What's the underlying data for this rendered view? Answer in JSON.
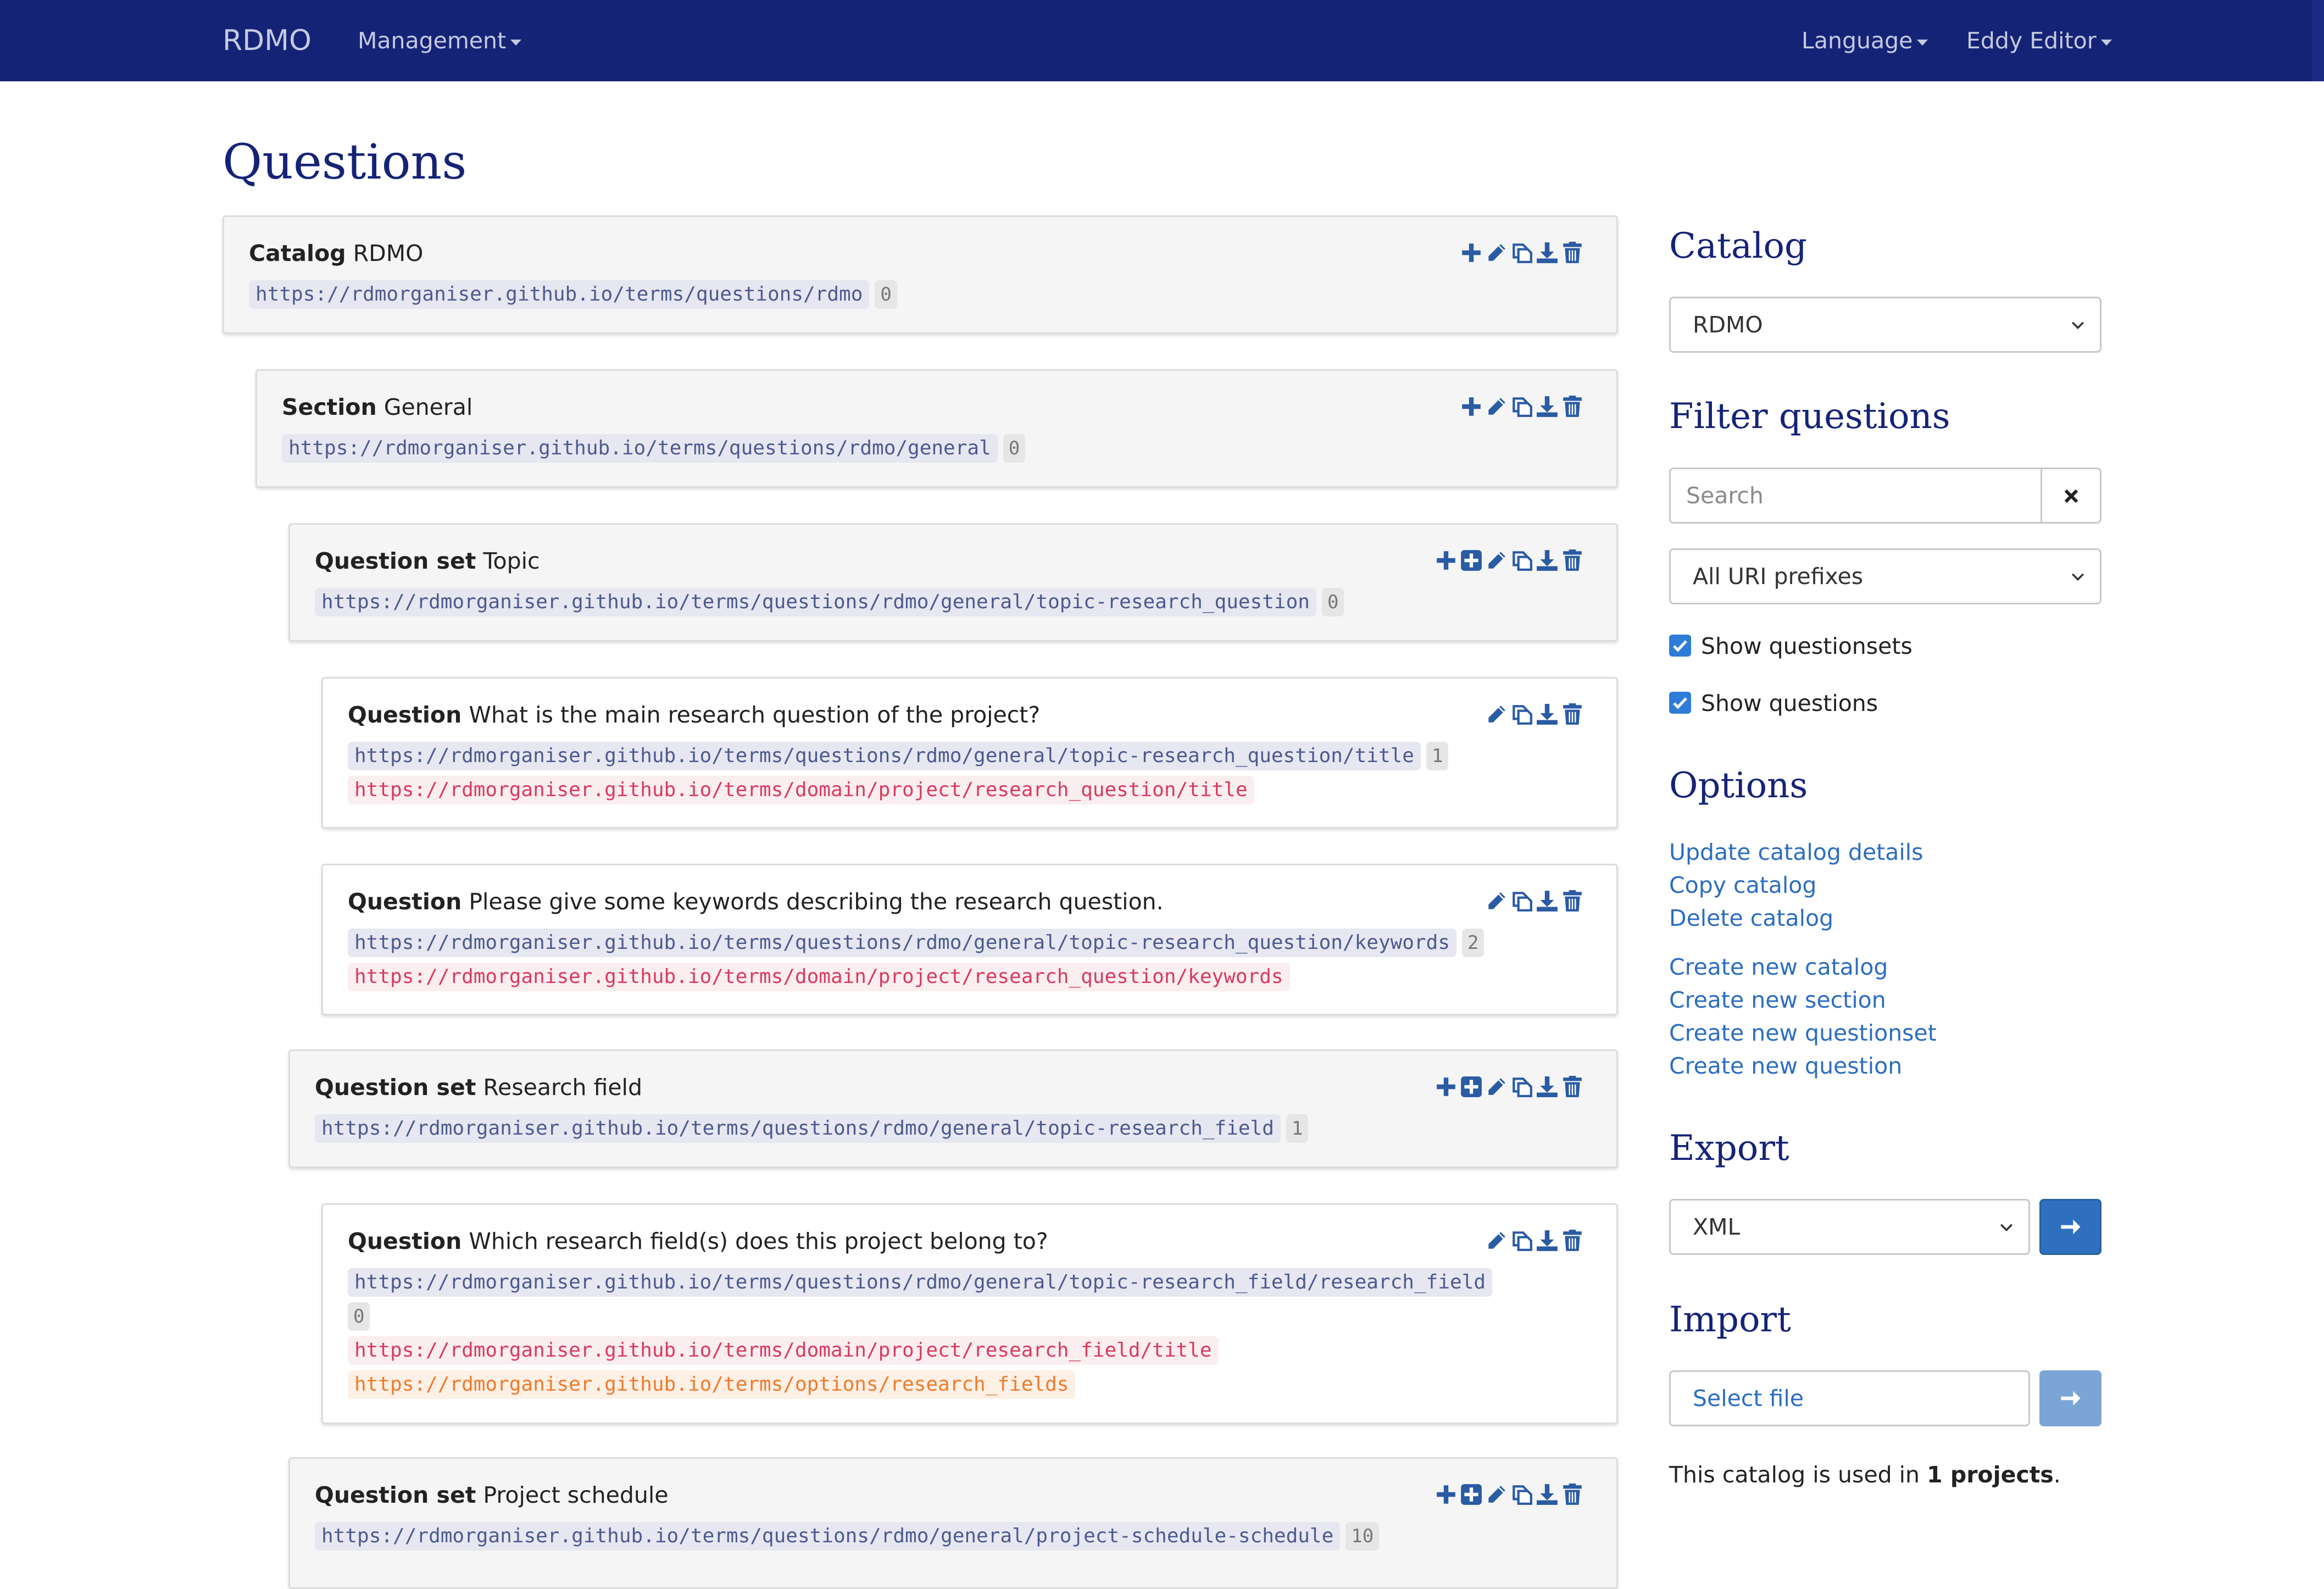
{
  "navbar": {
    "brand": "RDMO",
    "management": "Management",
    "language": "Language",
    "user": "Eddy Editor"
  },
  "page_title": "Questions",
  "elements": [
    {
      "type": "Catalog",
      "name": "RDMO",
      "uris": [
        {
          "text": "https://rdmorganiser.github.io/terms/questions/rdmo",
          "kind": "uri"
        }
      ],
      "count": "0"
    },
    {
      "type": "Section",
      "name": "General",
      "uris": [
        {
          "text": "https://rdmorganiser.github.io/terms/questions/rdmo/general",
          "kind": "uri"
        }
      ],
      "count": "0"
    },
    {
      "type": "Question set",
      "name": "Topic",
      "uris": [
        {
          "text": "https://rdmorganiser.github.io/terms/questions/rdmo/general/topic-research_question",
          "kind": "uri"
        }
      ],
      "count": "0"
    },
    {
      "type": "Question",
      "name": "What is the main research question of the project?",
      "uris": [
        {
          "text": "https://rdmorganiser.github.io/terms/questions/rdmo/general/topic-research_question/title",
          "kind": "uri"
        },
        {
          "text": "https://rdmorganiser.github.io/terms/domain/project/research_question/title",
          "kind": "attribute"
        }
      ],
      "count": "1"
    },
    {
      "type": "Question",
      "name": "Please give some keywords describing the research question.",
      "uris": [
        {
          "text": "https://rdmorganiser.github.io/terms/questions/rdmo/general/topic-research_question/keywords",
          "kind": "uri"
        },
        {
          "text": "https://rdmorganiser.github.io/terms/domain/project/research_question/keywords",
          "kind": "attribute"
        }
      ],
      "count": "2"
    },
    {
      "type": "Question set",
      "name": "Research field",
      "uris": [
        {
          "text": "https://rdmorganiser.github.io/terms/questions/rdmo/general/topic-research_field",
          "kind": "uri"
        }
      ],
      "count": "1"
    },
    {
      "type": "Question",
      "name": "Which research field(s) does this project belong to?",
      "uris": [
        {
          "text": "https://rdmorganiser.github.io/terms/questions/rdmo/general/topic-research_field/research_field",
          "kind": "uri"
        },
        {
          "text": "https://rdmorganiser.github.io/terms/domain/project/research_field/title",
          "kind": "attribute"
        },
        {
          "text": "https://rdmorganiser.github.io/terms/options/research_fields",
          "kind": "optionset"
        }
      ],
      "count": "0"
    },
    {
      "type": "Question set",
      "name": "Project schedule",
      "uris": [
        {
          "text": "https://rdmorganiser.github.io/terms/questions/rdmo/general/project-schedule-schedule",
          "kind": "uri"
        }
      ],
      "count": "10"
    }
  ],
  "action_icons": {
    "add": "plus-icon",
    "add_child": "plus-square-icon",
    "edit": "pencil-icon",
    "copy": "copy-icon",
    "export": "download-icon",
    "delete": "trash-icon"
  },
  "sidebar": {
    "catalog_heading": "Catalog",
    "catalog_selected": "RDMO",
    "filter_heading": "Filter questions",
    "search_placeholder": "Search",
    "uri_prefix_selected": "All URI prefixes",
    "show_questionsets": "Show questionsets",
    "show_questions": "Show questions",
    "options_heading": "Options",
    "options_links": [
      "Update catalog details",
      "Copy catalog",
      "Delete catalog"
    ],
    "create_links": [
      "Create new catalog",
      "Create new section",
      "Create new questionset",
      "Create new question"
    ],
    "export_heading": "Export",
    "export_format": "XML",
    "import_heading": "Import",
    "select_file": "Select file",
    "usage_prefix": "This catalog is used in",
    "usage_count": "1 projects",
    "usage_suffix": "."
  },
  "colors": {
    "navbar": "#152377",
    "heading": "#152377",
    "link": "#2c6dc0",
    "uri_bg": "#e6e7f0",
    "attribute_text": "#d93a5e",
    "optionset_text": "#f07a2a",
    "button": "#2f6fbf"
  }
}
